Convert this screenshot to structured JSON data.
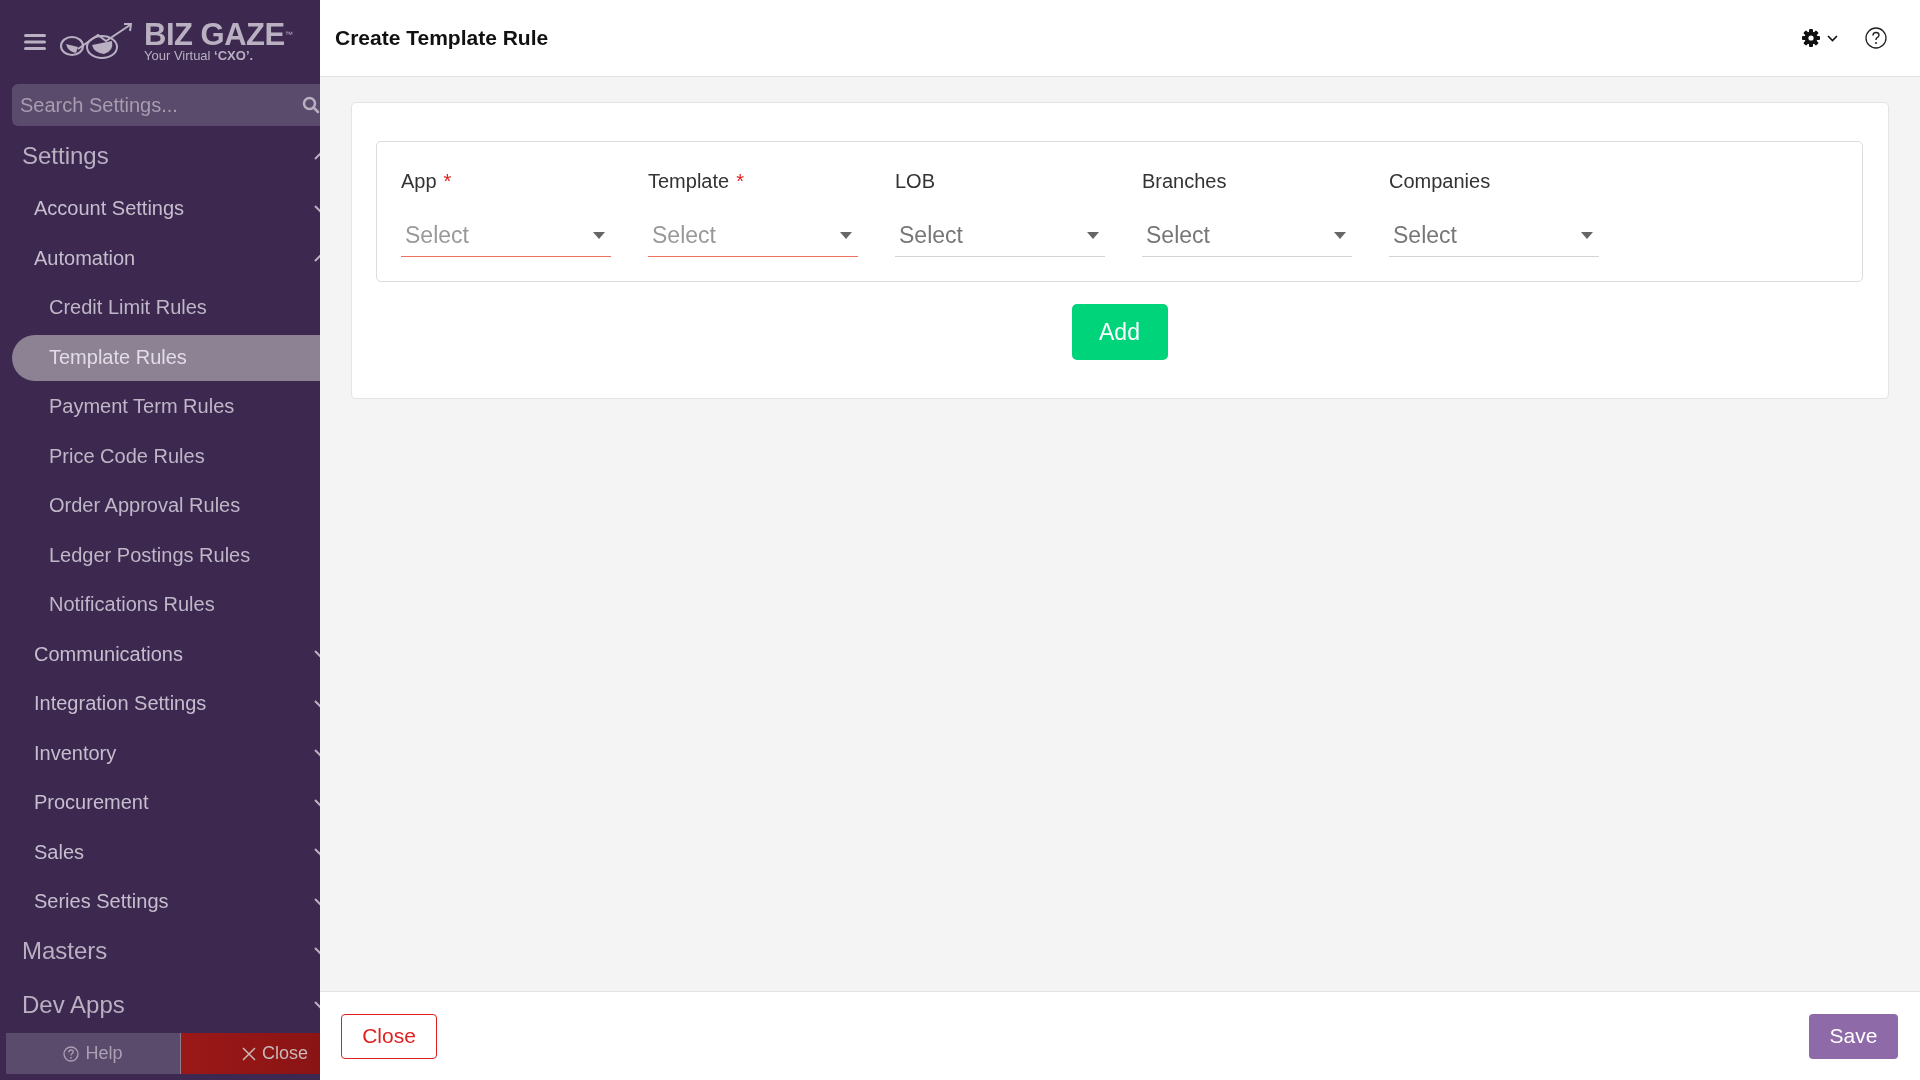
{
  "sidebar": {
    "logo": {
      "name": "BIZ GAZE",
      "tm": "™",
      "tagline_prefix": "Your Virtual",
      "tagline_bold": "‘CXO’."
    },
    "search": {
      "placeholder": "Search Settings..."
    },
    "sections": [
      {
        "label": "Settings",
        "expanded": true,
        "children": [
          {
            "label": "Account Settings",
            "expanded": false
          },
          {
            "label": "Automation",
            "expanded": true,
            "children": [
              {
                "label": "Credit Limit Rules",
                "selected": false
              },
              {
                "label": "Template Rules",
                "selected": true
              },
              {
                "label": "Payment Term Rules",
                "selected": false
              },
              {
                "label": "Price Code Rules",
                "selected": false
              },
              {
                "label": "Order Approval Rules",
                "selected": false
              },
              {
                "label": "Ledger Postings Rules",
                "selected": false
              },
              {
                "label": "Notifications Rules",
                "selected": false
              }
            ]
          },
          {
            "label": "Communications",
            "expanded": false
          },
          {
            "label": "Integration Settings",
            "expanded": false
          },
          {
            "label": "Inventory",
            "expanded": false
          },
          {
            "label": "Procurement",
            "expanded": false
          },
          {
            "label": "Sales",
            "expanded": false
          },
          {
            "label": "Series Settings",
            "expanded": false
          }
        ]
      },
      {
        "label": "Masters",
        "expanded": false
      },
      {
        "label": "Dev Apps",
        "expanded": false
      }
    ],
    "help_button": "Help",
    "close_button": "Close"
  },
  "header": {
    "title": "Create Template Rule"
  },
  "form": {
    "fields": [
      {
        "label": "App",
        "required": true,
        "placeholder": "Select"
      },
      {
        "label": "Template",
        "required": true,
        "placeholder": "Select"
      },
      {
        "label": "LOB",
        "required": false,
        "placeholder": "Select"
      },
      {
        "label": "Branches",
        "required": false,
        "placeholder": "Select"
      },
      {
        "label": "Companies",
        "required": false,
        "placeholder": "Select"
      }
    ],
    "required_mark": "*",
    "add_button": "Add"
  },
  "footer": {
    "close_button": "Close",
    "save_button": "Save"
  }
}
